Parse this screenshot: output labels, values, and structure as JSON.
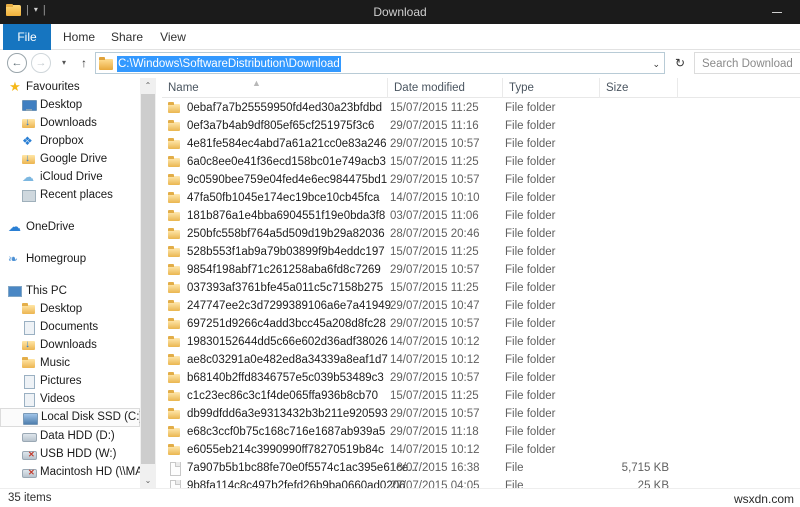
{
  "window": {
    "title": "Download",
    "minimize_label": "minimize",
    "quick_access_separator": "|",
    "quick_access_caret": "▾"
  },
  "ribbon": {
    "tabs": [
      {
        "label": "File",
        "active": true
      },
      {
        "label": "Home",
        "active": false
      },
      {
        "label": "Share",
        "active": false
      },
      {
        "label": "View",
        "active": false
      }
    ]
  },
  "navbar": {
    "back_icon": "←",
    "forward_icon": "→",
    "recent_icon": "▾",
    "up_icon": "↑",
    "address_value": "C:\\Windows\\SoftwareDistribution\\Download",
    "address_dropdown_icon": "⌄",
    "refresh_icon": "↻",
    "search_placeholder": "Search Download"
  },
  "sidebar": {
    "groups": [
      {
        "header": {
          "label": "Favourites",
          "icon": "star-icon",
          "icon_class": "ic-star"
        },
        "items": [
          {
            "label": "Desktop",
            "icon": "desktop-icon",
            "icon_class": "ic-monitor"
          },
          {
            "label": "Downloads",
            "icon": "downloads-folder-icon",
            "icon_class": "ic-dl"
          },
          {
            "label": "Dropbox",
            "icon": "dropbox-icon",
            "icon_class": "ic-dropbox",
            "glyph": "❖"
          },
          {
            "label": "Google Drive",
            "icon": "google-drive-folder-icon",
            "icon_class": "ic-dl"
          },
          {
            "label": "iCloud Drive",
            "icon": "icloud-icon",
            "icon_class": "ic-cloud",
            "glyph": "☁"
          },
          {
            "label": "Recent places",
            "icon": "recent-places-icon",
            "icon_class": "ic-recent"
          }
        ]
      },
      {
        "header": {
          "label": "OneDrive",
          "icon": "onedrive-icon",
          "icon_class": "ic-onedrive",
          "glyph": "☁"
        },
        "items": []
      },
      {
        "header": {
          "label": "Homegroup",
          "icon": "homegroup-icon",
          "icon_class": "ic-home",
          "glyph": "❧"
        },
        "items": []
      },
      {
        "header": {
          "label": "This PC",
          "icon": "this-pc-icon",
          "icon_class": "ic-pc"
        },
        "items": [
          {
            "label": "Desktop",
            "icon": "desktop-folder-icon",
            "icon_class": "ic-folder"
          },
          {
            "label": "Documents",
            "icon": "documents-folder-icon",
            "icon_class": "ic-doc"
          },
          {
            "label": "Downloads",
            "icon": "downloads-folder-icon",
            "icon_class": "ic-dl"
          },
          {
            "label": "Music",
            "icon": "music-folder-icon",
            "icon_class": "ic-folder"
          },
          {
            "label": "Pictures",
            "icon": "pictures-folder-icon",
            "icon_class": "ic-doc"
          },
          {
            "label": "Videos",
            "icon": "videos-folder-icon",
            "icon_class": "ic-doc"
          },
          {
            "label": "Local Disk SSD (C:)",
            "icon": "local-disk-icon",
            "icon_class": "ic-hddc",
            "selected": true
          },
          {
            "label": "Data HDD (D:)",
            "icon": "hard-drive-icon",
            "icon_class": "ic-hdd"
          },
          {
            "label": "USB HDD (W:)",
            "icon": "usb-drive-disconnected-icon",
            "icon_class": "ic-usb"
          },
          {
            "label": "Macintosh HD (\\\\MA",
            "icon": "network-drive-icon",
            "icon_class": "ic-usb"
          }
        ]
      }
    ],
    "scroll_up_icon": "⌃",
    "scroll_down_icon": "⌄"
  },
  "filelist": {
    "columns": [
      {
        "label": "Name",
        "sorted": true,
        "sort_icon": "▲"
      },
      {
        "label": "Date modified"
      },
      {
        "label": "Type"
      },
      {
        "label": "Size"
      }
    ],
    "rows": [
      {
        "name": "0ebaf7a7b25559950fd4ed30a23bfdbd",
        "date": "15/07/2015 11:25",
        "type": "File folder",
        "size": "",
        "kind": "folder"
      },
      {
        "name": "0ef3a7b4ab9df805ef65cf251975f3c6",
        "date": "29/07/2015 11:16",
        "type": "File folder",
        "size": "",
        "kind": "folder"
      },
      {
        "name": "4e81fe584ec4abd7a61a21cc0e83a246",
        "date": "29/07/2015 10:57",
        "type": "File folder",
        "size": "",
        "kind": "folder"
      },
      {
        "name": "6a0c8ee0e41f36ecd158bc01e749acb3",
        "date": "15/07/2015 11:25",
        "type": "File folder",
        "size": "",
        "kind": "folder"
      },
      {
        "name": "9c0590bee759e04fed4e6ec984475bd1",
        "date": "29/07/2015 10:57",
        "type": "File folder",
        "size": "",
        "kind": "folder"
      },
      {
        "name": "47fa50fb1045e174ec19bce10cb45fca",
        "date": "14/07/2015 10:10",
        "type": "File folder",
        "size": "",
        "kind": "folder"
      },
      {
        "name": "181b876a1e4bba6904551f19e0bda3f8",
        "date": "03/07/2015 11:06",
        "type": "File folder",
        "size": "",
        "kind": "folder"
      },
      {
        "name": "250bfc558bf764a5d509d19b29a82036",
        "date": "28/07/2015 20:46",
        "type": "File folder",
        "size": "",
        "kind": "folder"
      },
      {
        "name": "528b553f1ab9a79b03899f9b4eddc197",
        "date": "15/07/2015 11:25",
        "type": "File folder",
        "size": "",
        "kind": "folder"
      },
      {
        "name": "9854f198abf71c261258aba6fd8c7269",
        "date": "29/07/2015 10:57",
        "type": "File folder",
        "size": "",
        "kind": "folder"
      },
      {
        "name": "037393af3761bfe45a011c5c7158b275",
        "date": "15/07/2015 11:25",
        "type": "File folder",
        "size": "",
        "kind": "folder"
      },
      {
        "name": "247747ee2c3d7299389106a6e7a41949",
        "date": "29/07/2015 10:47",
        "type": "File folder",
        "size": "",
        "kind": "folder"
      },
      {
        "name": "697251d9266c4add3bcc45a208d8fc28",
        "date": "29/07/2015 10:57",
        "type": "File folder",
        "size": "",
        "kind": "folder"
      },
      {
        "name": "19830152644dd5c66e602d36adf38026",
        "date": "14/07/2015 10:12",
        "type": "File folder",
        "size": "",
        "kind": "folder"
      },
      {
        "name": "ae8c03291a0e482ed8a34339a8eaf1d7",
        "date": "14/07/2015 10:12",
        "type": "File folder",
        "size": "",
        "kind": "folder"
      },
      {
        "name": "b68140b2ffd8346757e5c039b53489c3",
        "date": "29/07/2015 10:57",
        "type": "File folder",
        "size": "",
        "kind": "folder"
      },
      {
        "name": "c1c23ec86c3c1f4de065ffa936b8cb70",
        "date": "15/07/2015 11:25",
        "type": "File folder",
        "size": "",
        "kind": "folder"
      },
      {
        "name": "db99dfdd6a3e9313432b3b211e920593",
        "date": "29/07/2015 10:57",
        "type": "File folder",
        "size": "",
        "kind": "folder"
      },
      {
        "name": "e68c3ccf0b75c168c716e1687ab939a5",
        "date": "29/07/2015 11:18",
        "type": "File folder",
        "size": "",
        "kind": "folder"
      },
      {
        "name": "e6055eb214c3990990ff78270519b84c",
        "date": "14/07/2015 10:12",
        "type": "File folder",
        "size": "",
        "kind": "folder"
      },
      {
        "name": "7a907b5b1bc88fe70e0f5574c1ac395e61ce...",
        "date": "18/07/2015 16:38",
        "type": "File",
        "size": "5,715 KB",
        "kind": "file"
      },
      {
        "name": "9b8fa114c8c497b2fefd26b9ba0660ad0206",
        "date": "27/07/2015 04:05",
        "type": "File",
        "size": "25 KB",
        "kind": "file"
      }
    ]
  },
  "statusbar": {
    "item_count": "35 items"
  },
  "watermark": {
    "text": "wsxdn.com"
  }
}
